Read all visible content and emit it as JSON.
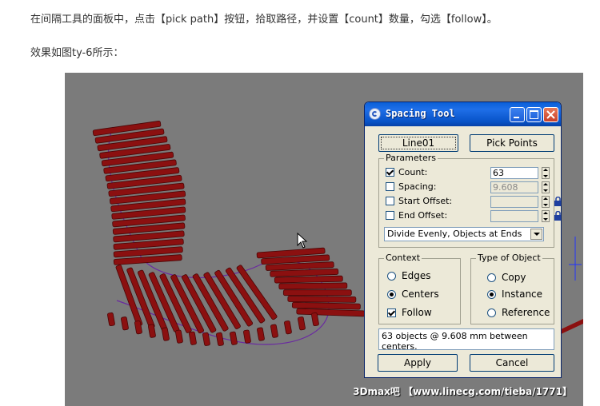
{
  "article": {
    "line1": "在间隔工具的面板中，点击【pick path】按钮，拾取路径，并设置【count】数量，勾选【follow】。",
    "line2": "效果如图ty-6所示："
  },
  "viewport": {
    "watermark": "3Dmax吧 【www.linecg.com/tieba/1771】"
  },
  "dialog": {
    "title": "Spacing Tool",
    "path_button": "Line01",
    "pick_points_button": "Pick Points",
    "parameters": {
      "group_label": "Parameters",
      "count": {
        "label": "Count:",
        "value": "63",
        "checked": true
      },
      "spacing": {
        "label": "Spacing:",
        "value": "9.608",
        "checked": false
      },
      "start_offset": {
        "label": "Start Offset:",
        "value": "",
        "checked": false
      },
      "end_offset": {
        "label": "End Offset:",
        "value": "",
        "checked": false
      },
      "distribution": "Divide Evenly, Objects at Ends"
    },
    "context": {
      "group_label": "Context",
      "edges": {
        "label": "Edges",
        "selected": false
      },
      "centers": {
        "label": "Centers",
        "selected": true
      },
      "follow": {
        "label": "Follow",
        "checked": true
      }
    },
    "type_of_object": {
      "group_label": "Type of Object",
      "copy": {
        "label": "Copy",
        "selected": false
      },
      "instance": {
        "label": "Instance",
        "selected": true
      },
      "reference": {
        "label": "Reference",
        "selected": false
      }
    },
    "status": "63 objects @ 9.608 mm between centers.",
    "apply_button": "Apply",
    "cancel_button": "Cancel"
  },
  "colors": {
    "titlebar": "#0a5fd8",
    "dialog_bg": "#ece9d8",
    "viewport_bg": "#7b7b7b",
    "slat": "#8b1010"
  },
  "icons": [
    "app-logo-icon",
    "minimize-icon",
    "maximize-icon",
    "close-icon",
    "lock-icon",
    "dropdown-arrow-icon",
    "mouse-cursor-icon"
  ]
}
